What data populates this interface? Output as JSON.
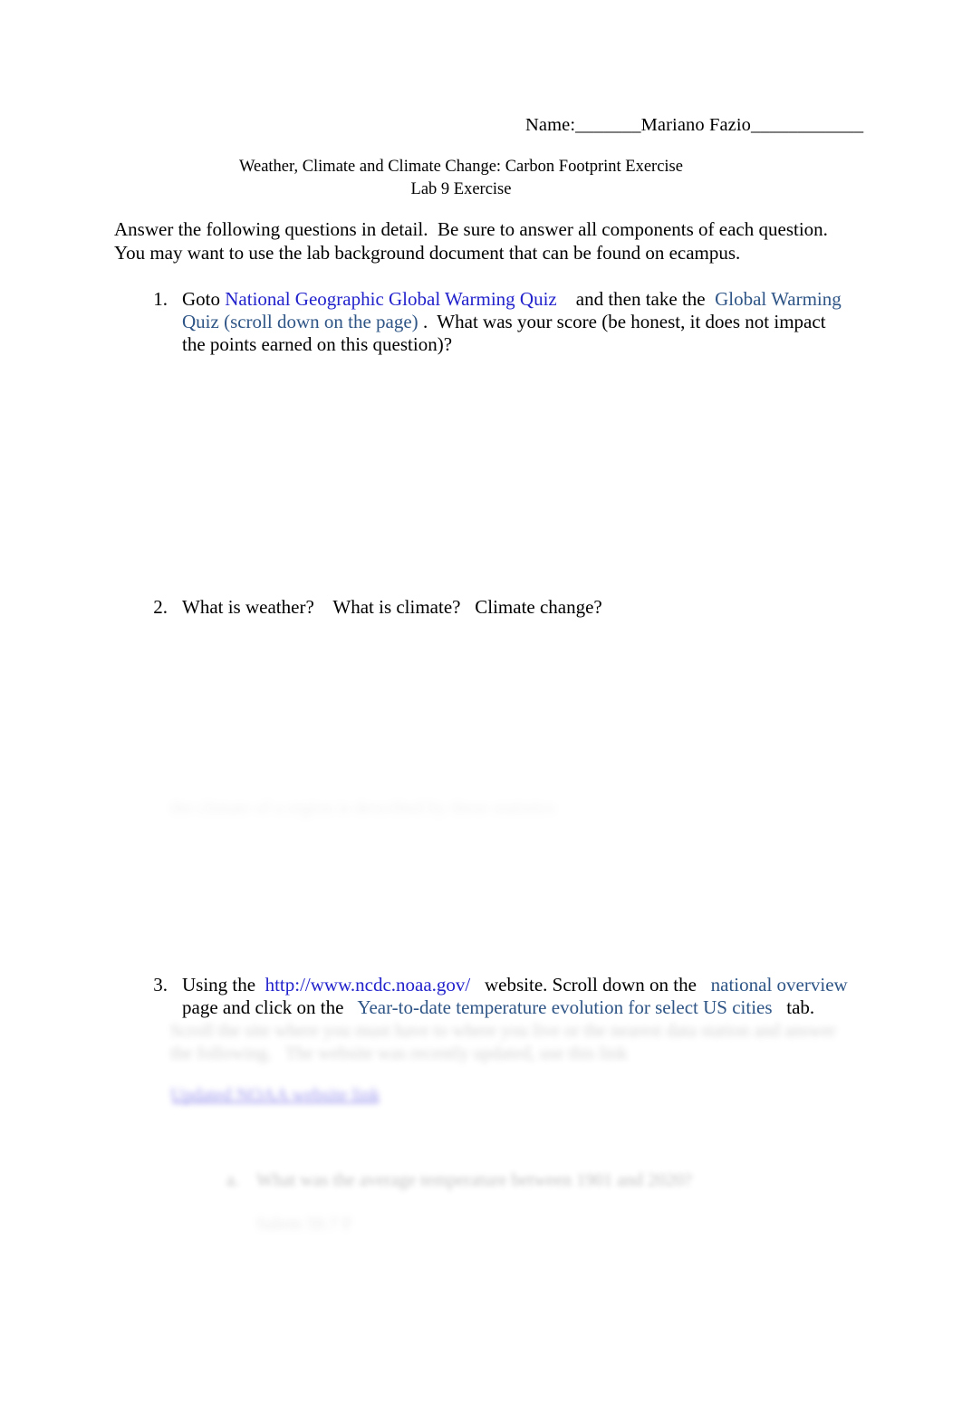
{
  "document": {
    "name_line": "Name:_______Mariano Fazio____________",
    "title_line_1": "Weather, Climate and Climate Change: Carbon Footprint Exercise",
    "title_line_2": "Lab 9 Exercise",
    "intro_line_1": "Answer the following questions in detail.  Be sure to answer all components of each question.",
    "intro_line_2": "You may want to use the lab background document that can be found on ecampus."
  },
  "questions": [
    {
      "number": "1.",
      "line_1_pre": "Goto ",
      "link_1": "National Geographic Global Warming Quiz",
      "line_1_mid": "    and then take the  ",
      "link_2_part_1": "Global Warming",
      "link_2_part_2": "Quiz (scroll down on the page)",
      "line_2_post": " .  What was your score (be honest, it does not impact",
      "line_3": "the points earned on this question)?"
    },
    {
      "number": "2.",
      "line_1": "What is weather?    What is climate?   Climate change?"
    },
    {
      "number": "3.",
      "line_1_pre": "Using the  ",
      "link_url": "http://www.ncdc.noaa.gov/",
      "line_1_mid": "   website. Scroll down on the   ",
      "link_national_overview": "national overview",
      "line_2_pre": "page and click on the   ",
      "link_ytd": "Year-to-date temperature evolution for select US cities",
      "line_2_post": "   tab."
    }
  ],
  "obscured": {
    "q2_answer_line": "the climate of a region is described by these statistics",
    "q3_body_line_1": "Scroll the site where you must have to where you live or the nearest data station and answer",
    "q3_body_line_2": "the following.   The website was recently updated, use this link",
    "q3_link": "Updated NOAA website link",
    "q3_sub_a_marker": "a.",
    "q3_sub_a_text": "What was the average temperature between 1901 and 2020?",
    "q3_sub_a_answer": "Salem 50.7 F"
  },
  "colors": {
    "link_strong": "#2222cc",
    "link_navy": "#2e5586",
    "link_visited": "#7b74e8",
    "text": "#000000",
    "page_background": "#ffffff"
  }
}
